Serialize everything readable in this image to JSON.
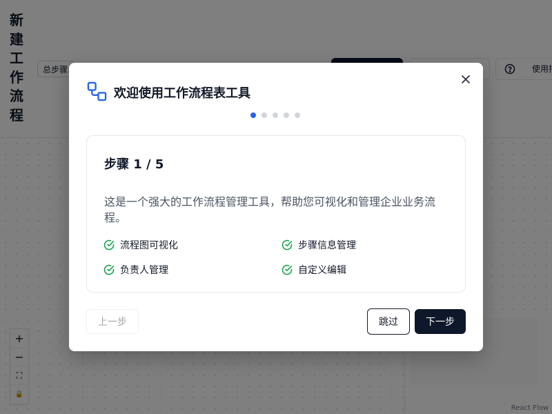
{
  "app": {
    "title_chars": [
      "新",
      "建",
      "工",
      "作",
      "流",
      "程"
    ],
    "step_count_label": "总步骤:",
    "guide_label": "使用指南",
    "attribution": "React Flow",
    "controls": {
      "zoom_in": "+",
      "zoom_out": "−",
      "fit_view": "⛶",
      "lock": "🔒"
    }
  },
  "modal": {
    "title": "欢迎使用工作流程表工具",
    "total_steps": 5,
    "current_step": 1,
    "card": {
      "step_label": "步骤 1 / 5",
      "description": "这是一个强大的工作流程管理工具，帮助您可视化和管理企业业务流程。",
      "features": [
        "流程图可视化",
        "步骤信息管理",
        "负责人管理",
        "自定义编辑"
      ]
    },
    "buttons": {
      "prev": "上一步",
      "skip": "跳过",
      "next": "下一步"
    }
  },
  "colors": {
    "accent": "#2563eb",
    "success": "#16a34a",
    "primary_dark": "#0f172a",
    "overlay": "rgba(0,0,0,0.5)"
  },
  "icons": {
    "logo": "workflow-icon",
    "close": "close-icon",
    "feature_check": "check-circle-icon",
    "help": "help-circle-icon"
  }
}
